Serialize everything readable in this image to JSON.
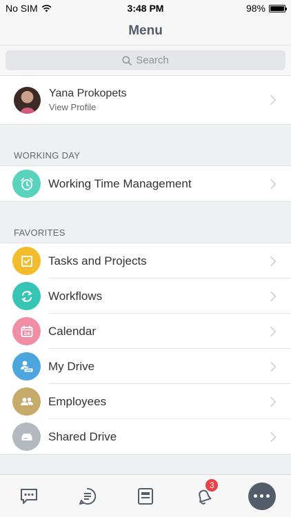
{
  "status_bar": {
    "carrier": "No SIM",
    "time": "3:48 PM",
    "battery": "98%",
    "battery_level": 0.98
  },
  "header": {
    "title": "Menu"
  },
  "search": {
    "placeholder": "Search"
  },
  "profile": {
    "name": "Yana Prokopets",
    "subtitle": "View Profile"
  },
  "working_day": {
    "header": "WORKING DAY",
    "items": [
      {
        "label": "Working Time Management",
        "icon": "alarm-clock-icon",
        "color": "#59d3be"
      }
    ]
  },
  "favorites": {
    "header": "FAVORITES",
    "items": [
      {
        "label": "Tasks and Projects",
        "icon": "checkbox-icon",
        "color": "#f3bc2c"
      },
      {
        "label": "Workflows",
        "icon": "sync-arrows-icon",
        "color": "#36c4b5"
      },
      {
        "label": "Calendar",
        "icon": "calendar-icon",
        "color": "#f08ea6",
        "icon_text": "24"
      },
      {
        "label": "My Drive",
        "icon": "user-drive-icon",
        "color": "#4ba6dd"
      },
      {
        "label": "Employees",
        "icon": "users-icon",
        "color": "#c6aa6a"
      },
      {
        "label": "Shared Drive",
        "icon": "drive-icon",
        "color": "#b4b8bf"
      }
    ]
  },
  "tab_bar": {
    "items": [
      {
        "icon": "chat-bubble-icon"
      },
      {
        "icon": "activity-stream-icon"
      },
      {
        "icon": "tasks-list-icon"
      },
      {
        "icon": "bell-icon",
        "badge": "3"
      },
      {
        "icon": "more-icon"
      }
    ]
  },
  "colors": {
    "accent": "#535c69",
    "badge": "#e9424a"
  }
}
